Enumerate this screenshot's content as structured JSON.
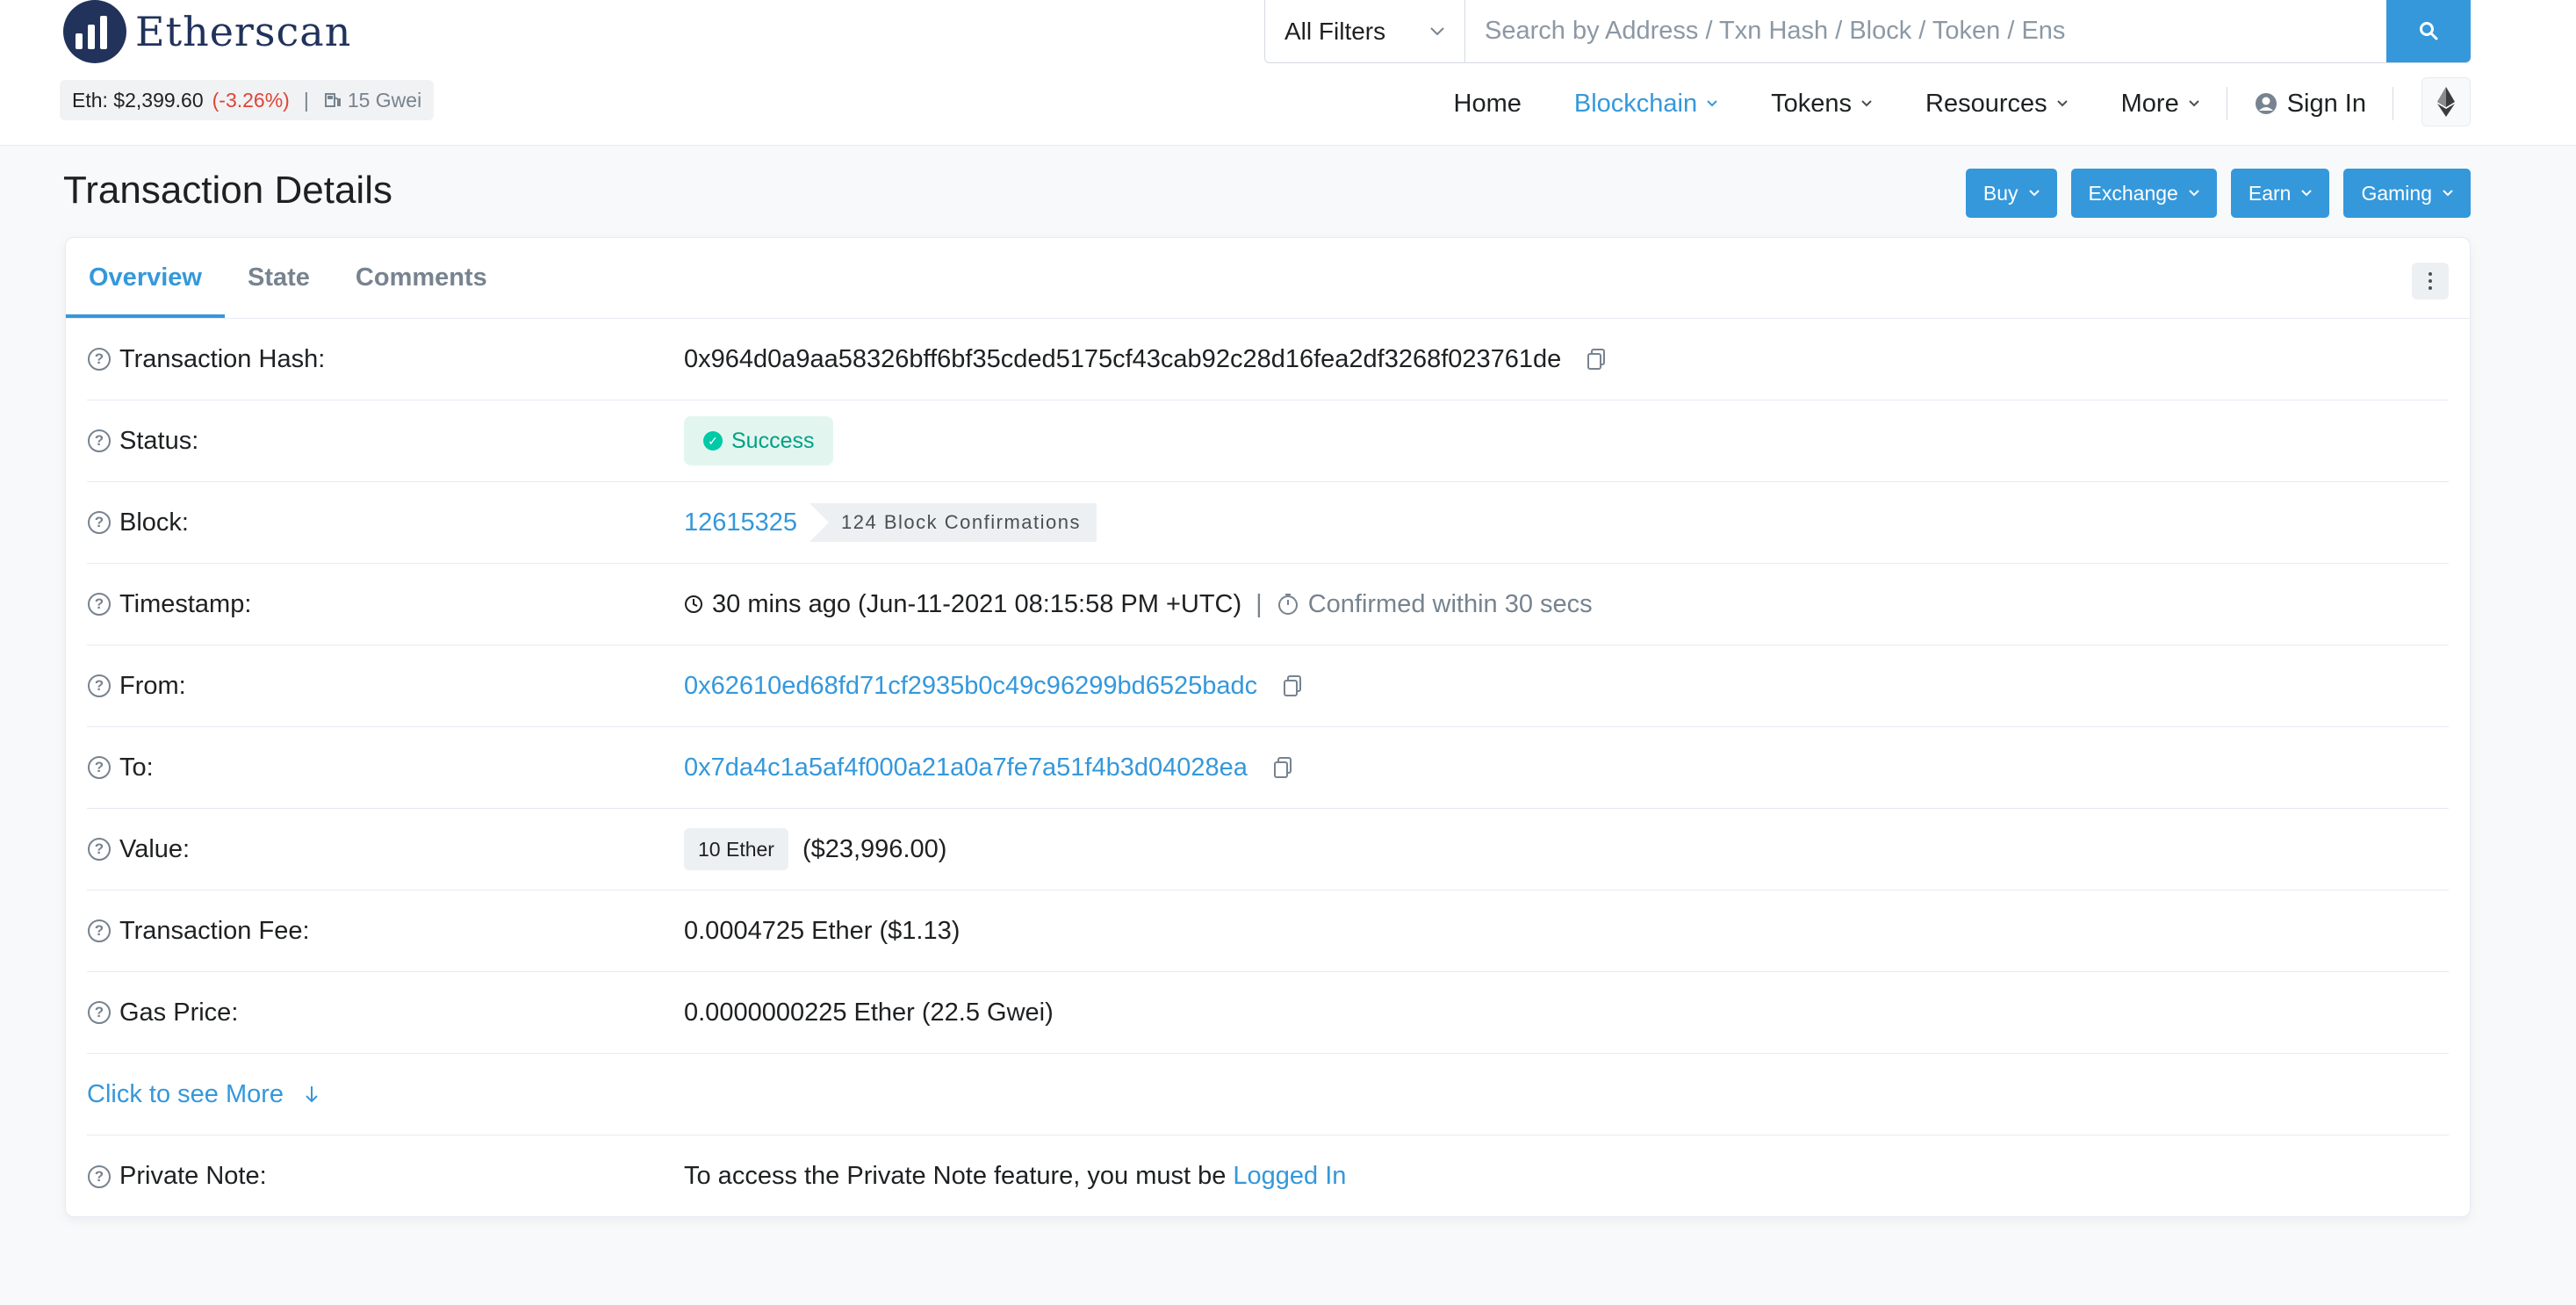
{
  "header": {
    "logo_text": "Etherscan",
    "eth_price_label": "Eth: $2,399.60",
    "eth_change": "(-3.26%)",
    "separator": "|",
    "gas": "15 Gwei",
    "filter_label": "All Filters",
    "search_placeholder": "Search by Address / Txn Hash / Block / Token / Ens",
    "nav": {
      "home": "Home",
      "blockchain": "Blockchain",
      "tokens": "Tokens",
      "resources": "Resources",
      "more": "More",
      "sign_in": "Sign In"
    }
  },
  "page": {
    "title": "Transaction Details",
    "buttons": [
      "Buy",
      "Exchange",
      "Earn",
      "Gaming"
    ]
  },
  "tabs": [
    "Overview",
    "State",
    "Comments"
  ],
  "details": {
    "hash_label": "Transaction Hash:",
    "hash": "0x964d0a9aa58326bff6bf35cded5175cf43cab92c28d16fea2df3268f023761de",
    "status_label": "Status:",
    "status": "Success",
    "block_label": "Block:",
    "block": "12615325",
    "confirmations": "124 Block Confirmations",
    "timestamp_label": "Timestamp:",
    "timestamp": "30 mins ago (Jun-11-2021 08:15:58 PM +UTC)",
    "timestamp_sep": "|",
    "confirmed_within": "Confirmed within 30 secs",
    "from_label": "From:",
    "from": "0x62610ed68fd71cf2935b0c49c96299bd6525badc",
    "to_label": "To:",
    "to": "0x7da4c1a5af4f000a21a0a7fe7a51f4b3d04028ea",
    "value_label": "Value:",
    "value_ether": "10 Ether",
    "value_usd": "($23,996.00)",
    "fee_label": "Transaction Fee:",
    "fee": "0.0004725 Ether ($1.13)",
    "gas_label": "Gas Price:",
    "gas_price": "0.0000000225 Ether (22.5 Gwei)",
    "more_link": "Click to see More",
    "note_label": "Private Note:",
    "note_text": "To access the Private Note feature, you must be",
    "note_link": "Logged In"
  },
  "colors": {
    "accent": "#3498db",
    "success": "#00c9a7",
    "negative": "#de4437"
  }
}
